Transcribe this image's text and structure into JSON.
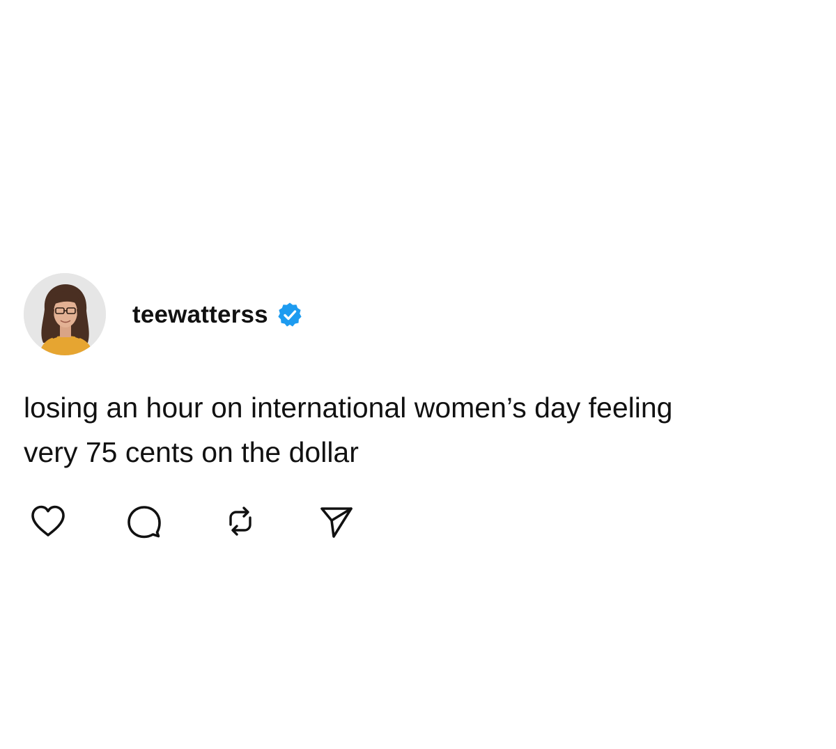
{
  "post": {
    "author": {
      "username": "teewatterss",
      "avatar_icon": "profile-photo-avatar",
      "verified_icon": "verified-badge-icon",
      "verified_color": "#1d9bf0"
    },
    "text_lines": [
      "losing an hour on international women’s day feeling",
      "very 75 cents on the dollar"
    ],
    "actions": [
      {
        "icon": "heart-icon"
      },
      {
        "icon": "comment-icon"
      },
      {
        "icon": "repost-icon"
      },
      {
        "icon": "share-icon"
      }
    ]
  },
  "colors": {
    "background": "#ffffff",
    "text": "#111111",
    "icon": "#111111",
    "accent": "#1d9bf0"
  }
}
